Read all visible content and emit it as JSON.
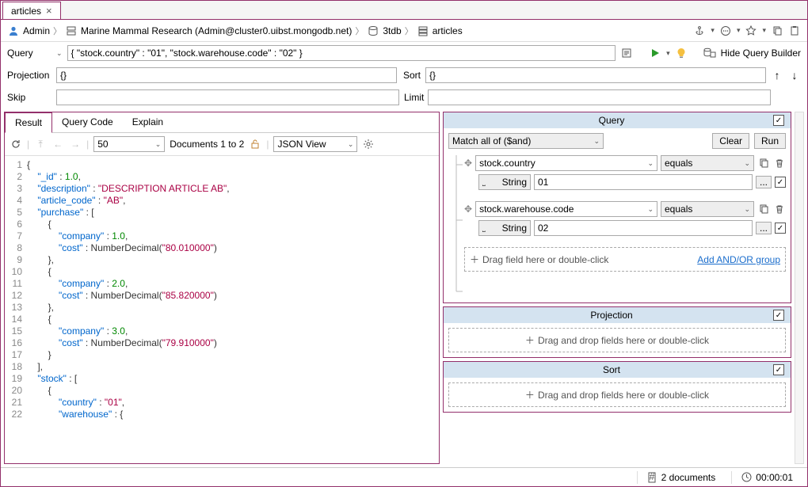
{
  "tab": {
    "title": "articles"
  },
  "breadcrumb": {
    "user": "Admin",
    "server": "Marine Mammal Research (Admin@cluster0.uibst.mongodb.net)",
    "db": "3tdb",
    "coll": "articles"
  },
  "query": {
    "label": "Query",
    "value": "{ \"stock.country\" : \"01\", \"stock.warehouse.code\" : \"02\" }",
    "projection_label": "Projection",
    "projection_value": "{}",
    "sort_label": "Sort",
    "sort_value": "{}",
    "skip_label": "Skip",
    "skip_value": "",
    "limit_label": "Limit",
    "limit_value": "",
    "hide_builder": "Hide Query Builder"
  },
  "result_tabs": {
    "result": "Result",
    "code": "Query Code",
    "explain": "Explain"
  },
  "result_toolbar": {
    "page_size": "50",
    "docs_label": "Documents 1 to 2",
    "view_mode": "JSON View"
  },
  "builder": {
    "query_title": "Query",
    "match_mode": "Match all of ($and)",
    "projection_title": "Projection",
    "sort_title": "Sort",
    "clear": "Clear",
    "run": "Run",
    "drag_field": "Drag field here or double-click",
    "drag_drop": "Drag and drop fields here or double-click",
    "add_group": "Add AND/OR group",
    "type_string": "String",
    "conditions": [
      {
        "field": "stock.country",
        "op": "equals",
        "value": "01"
      },
      {
        "field": "stock.warehouse.code",
        "op": "equals",
        "value": "02"
      }
    ]
  },
  "status": {
    "doc_count": "2 documents",
    "elapsed": "00:00:01"
  },
  "json_result": {
    "_id": 1.0,
    "description": "DESCRIPTION ARTICLE AB",
    "article_code": "AB",
    "purchase": [
      {
        "company": 1.0,
        "cost": "80.010000"
      },
      {
        "company": 2.0,
        "cost": "85.820000"
      },
      {
        "company": 3.0,
        "cost": "79.910000"
      }
    ],
    "stock": [
      {
        "country": "01"
      }
    ]
  }
}
